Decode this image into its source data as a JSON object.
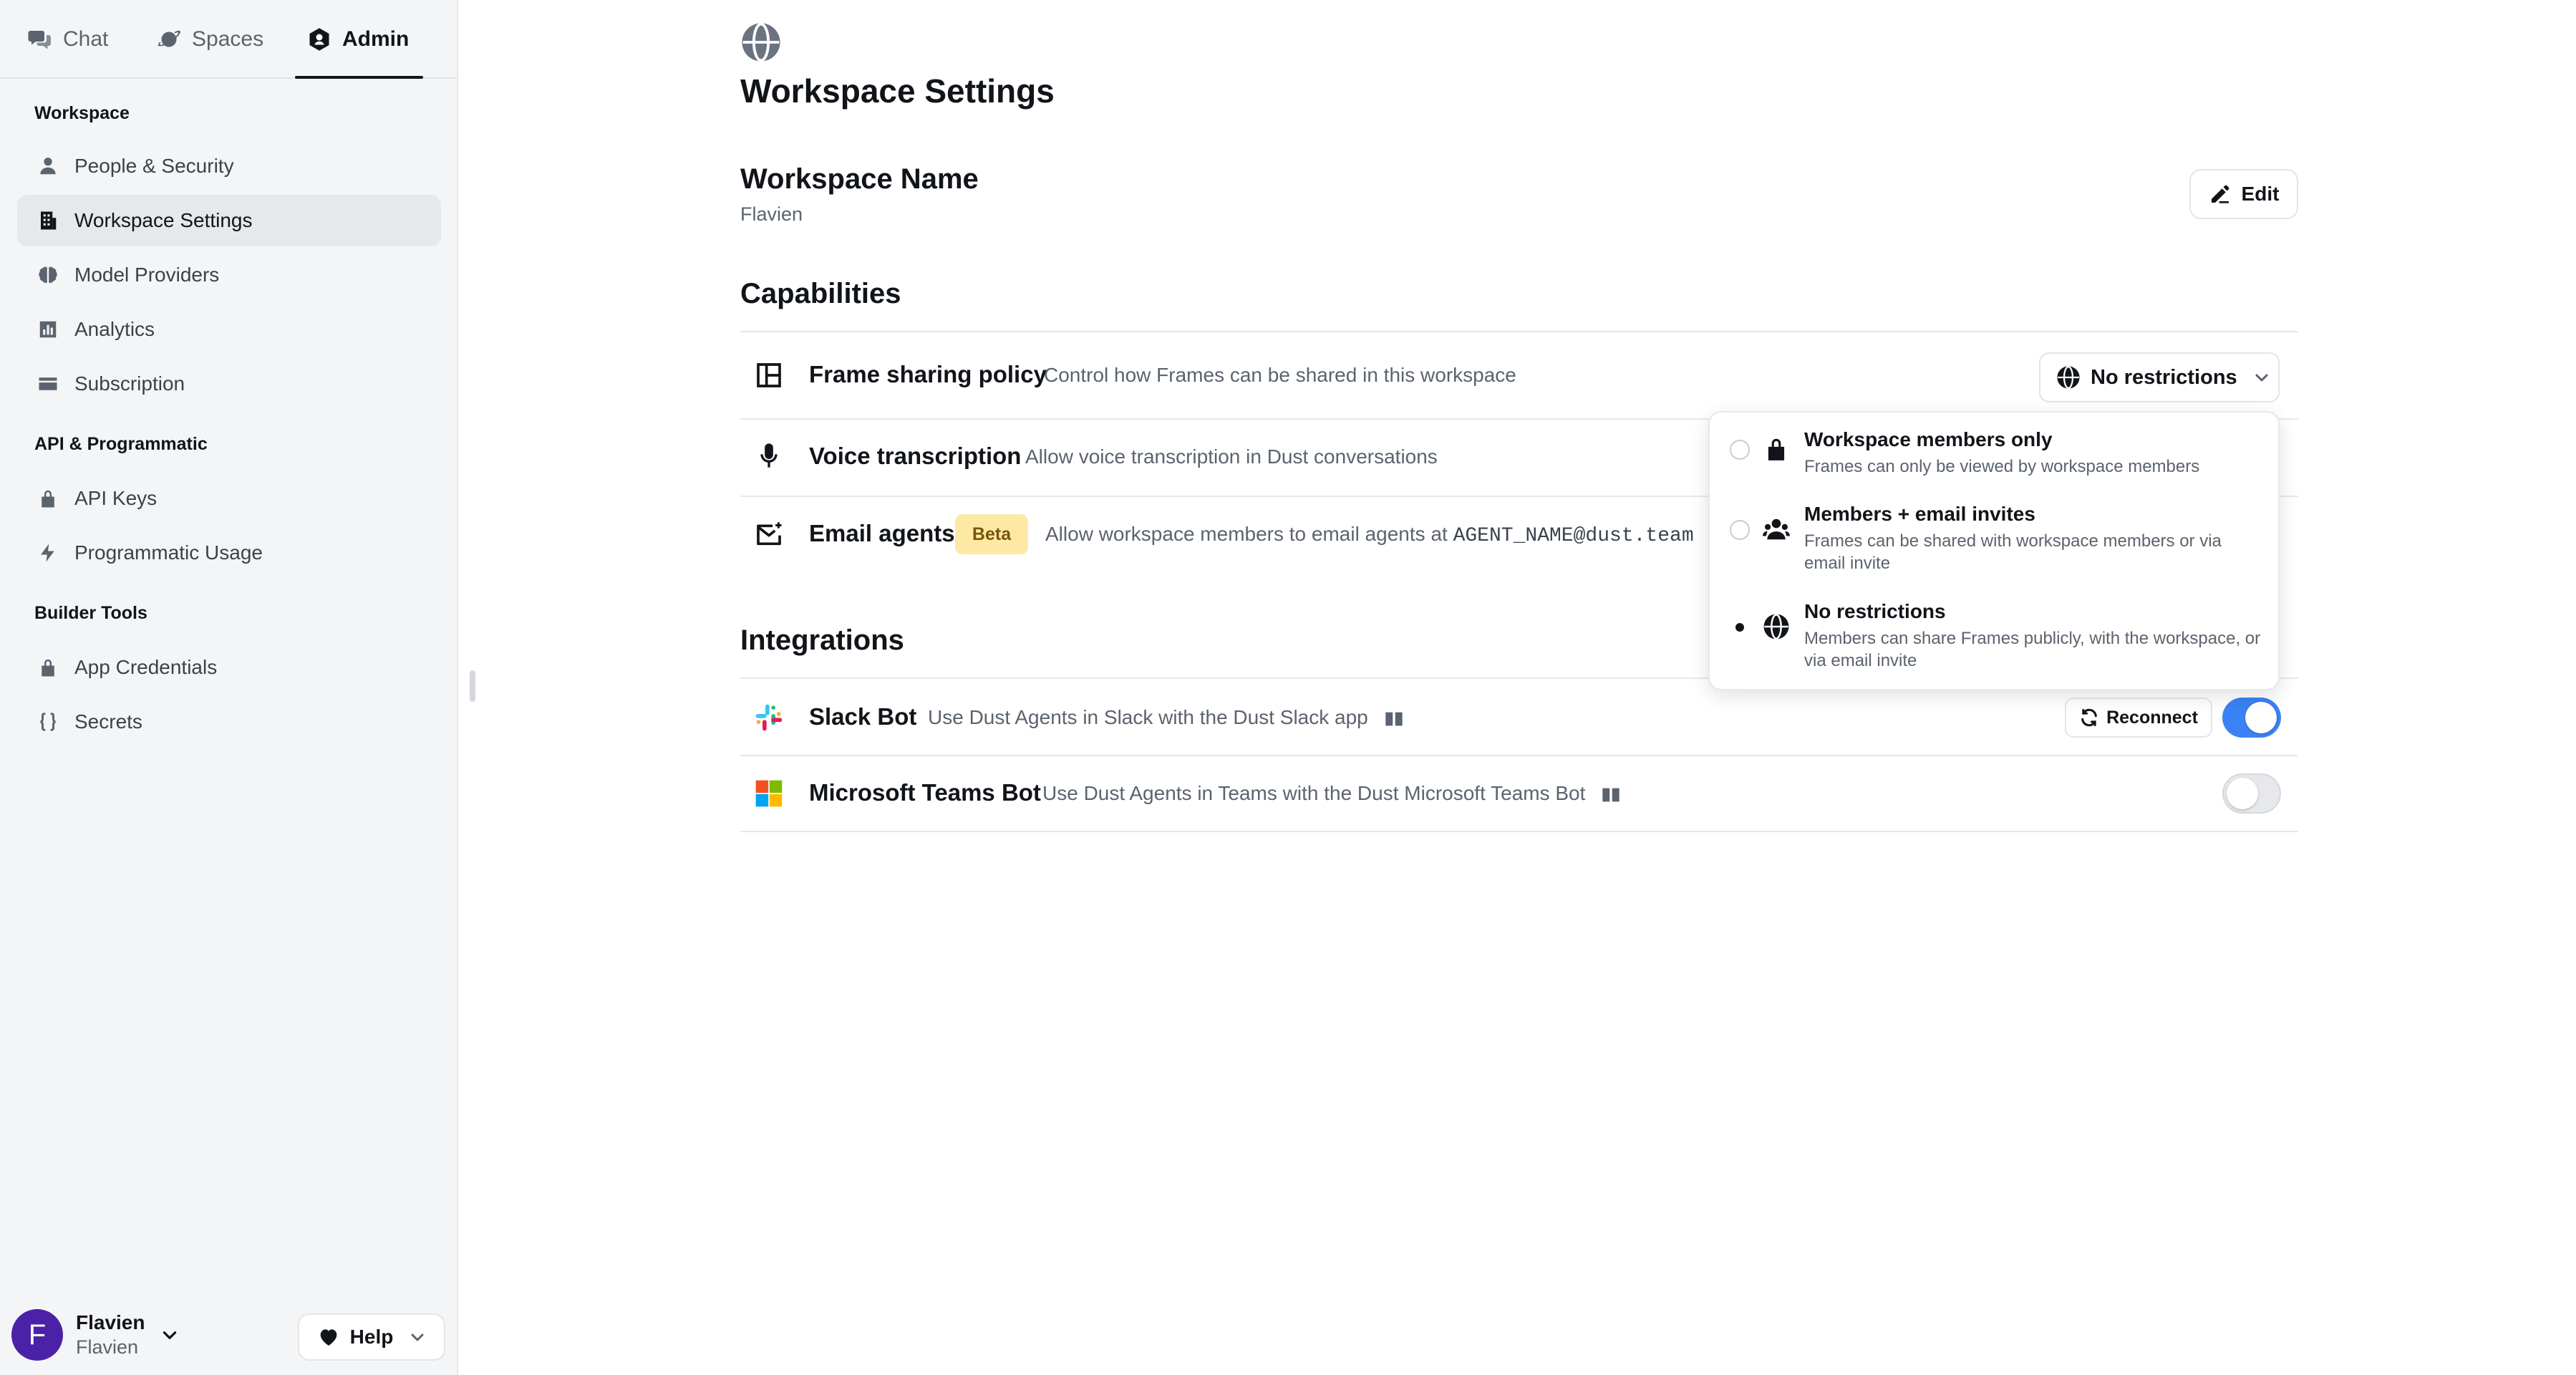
{
  "top_tabs": [
    {
      "label": "Chat",
      "icon": "chat-bubbles-icon"
    },
    {
      "label": "Spaces",
      "icon": "planet-icon"
    },
    {
      "label": "Admin",
      "icon": "admin-hexagon-icon",
      "active": true
    }
  ],
  "sidebar": {
    "sections": [
      {
        "label": "Workspace",
        "items": [
          {
            "label": "People & Security",
            "icon": "user-icon"
          },
          {
            "label": "Workspace Settings",
            "icon": "building-icon",
            "active": true
          },
          {
            "label": "Model Providers",
            "icon": "brain-icon"
          },
          {
            "label": "Analytics",
            "icon": "bar-chart-icon"
          },
          {
            "label": "Subscription",
            "icon": "card-icon"
          }
        ]
      },
      {
        "label": "API & Programmatic",
        "items": [
          {
            "label": "API Keys",
            "icon": "lock-icon"
          },
          {
            "label": "Programmatic Usage",
            "icon": "bolt-icon"
          }
        ]
      },
      {
        "label": "Builder Tools",
        "items": [
          {
            "label": "App Credentials",
            "icon": "key-icon"
          },
          {
            "label": "Secrets",
            "icon": "braces-icon"
          }
        ]
      }
    ],
    "user": {
      "initial": "F",
      "name": "Flavien",
      "sub": "Flavien"
    },
    "help_label": "Help"
  },
  "main": {
    "title": "Workspace Settings",
    "workspace_name": {
      "heading": "Workspace Name",
      "value": "Flavien",
      "edit_label": "Edit"
    },
    "capabilities": {
      "heading": "Capabilities",
      "frame_sharing": {
        "title": "Frame sharing policy",
        "desc": "Control how Frames can be shared in this workspace",
        "selected": "No restrictions"
      },
      "voice": {
        "title": "Voice transcription",
        "desc": "Allow voice transcription in Dust conversations"
      },
      "email": {
        "title": "Email agents",
        "badge": "Beta",
        "desc": "Allow workspace members to email agents at",
        "address": "AGENT_NAME@dust.team"
      }
    },
    "integrations": {
      "heading": "Integrations",
      "slack": {
        "title": "Slack Bot",
        "desc": "Use Dust Agents in Slack with the Dust Slack app",
        "reconnect_label": "Reconnect",
        "enabled": true
      },
      "teams": {
        "title": "Microsoft Teams Bot",
        "desc": "Use Dust Agents in Teams with the Dust Microsoft Teams Bot",
        "enabled": false
      }
    }
  },
  "dropdown": {
    "options": [
      {
        "title": "Workspace members only",
        "desc": "Frames can only be viewed by workspace members",
        "icon": "lock-icon",
        "checked": false
      },
      {
        "title": "Members + email invites",
        "desc": "Frames can be shared with workspace members or via email invite",
        "icon": "users-icon",
        "checked": false
      },
      {
        "title": "No restrictions",
        "desc": "Members can share Frames publicly, with the workspace, or via email invite",
        "icon": "globe-icon",
        "checked": true
      }
    ]
  },
  "colors": {
    "accent_toggle": "#3b82f6",
    "avatar": "#4b21a8",
    "beta_bg": "#fde9a4",
    "beta_text": "#7a5608"
  }
}
